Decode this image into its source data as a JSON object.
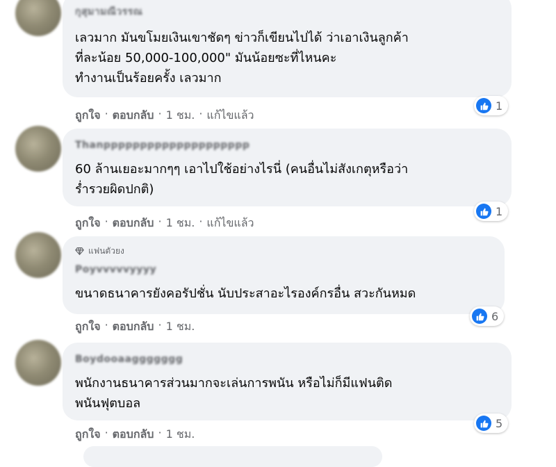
{
  "comments": [
    {
      "name": "กุสุมามณีวรรณ",
      "text": "เลวมาก มันขโมยเงินเขาชัดๆ ข่าวก็เขียนไปได้ ว่าเอาเงินลูกค้า\nที่ละน้อย 50,000-100,000\" มันน้อยซะที่ไหนคะ\nทำงานเป็นร้อยครั้ง เลวมาก",
      "like_label": "ถูกใจ",
      "reply_label": "ตอบกลับ",
      "time": "1 ชม.",
      "edited": "แก้ไขแล้ว",
      "reaction_count": "1"
    },
    {
      "name": "Thanpppppppppppppppppppp",
      "text": "60 ล้านเยอะมากๆๆ เอาไปใช้อย่างไรนี่ (คนอื่นไม่สังเกตุหรือว่า\nร่ำรวยผิดปกติ)",
      "like_label": "ถูกใจ",
      "reply_label": "ตอบกลับ",
      "time": "1 ชม.",
      "edited": "แก้ไขแล้ว",
      "reaction_count": "1"
    },
    {
      "badge": "แฟนตัวยง",
      "name": "Poyvvvvvyyyy",
      "text": "ขนาดธนาคารยังคอรัปชั่น นับประสาอะไรองค์กรอื่น สวะกันหมด",
      "like_label": "ถูกใจ",
      "reply_label": "ตอบกลับ",
      "time": "1 ชม.",
      "reaction_count": "6"
    },
    {
      "name": "Boydooaaggggggg",
      "text": "พนักงานธนาคารส่วนมากจะเล่นการพนัน หรือไม่ก็มีแฟนติด\nพนันฟุตบอล",
      "like_label": "ถูกใจ",
      "reply_label": "ตอบกลับ",
      "time": "1 ชม.",
      "reaction_count": "5"
    }
  ],
  "colors": {
    "bubble": "#f0f2f5",
    "meta_text": "#65676b",
    "like_blue": "#1877f2"
  },
  "icons": [
    "like-icon",
    "diamond-icon"
  ]
}
